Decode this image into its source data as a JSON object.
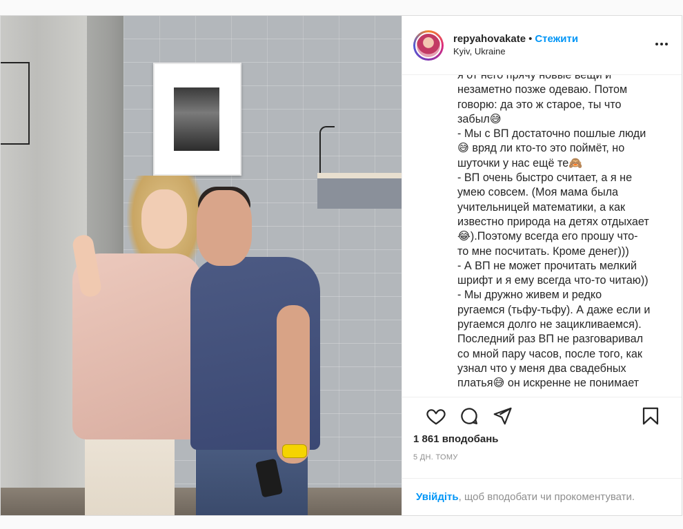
{
  "post": {
    "username": "repyahovakate",
    "separator": "•",
    "follow_label": "Стежити",
    "location": "Kyiv, Ukraine",
    "caption": "я от него прячу новые вещи и\nнезаметно позже одеваю. Потом\nговорю: да это ж старое, ты что\nзабыл😅\n- Мы с ВП достаточно пошлые люди\n😅 вряд ли кто-то это поймёт, но\nшуточки у нас ещё те🙈\n- ВП очень быстро считает, а я не\nумею совсем. (Моя мама была\nучительницей математики, а как\nизвестно природа на детях отдыхает\n😂).Поэтому всегда его прошу что-\nто мне посчитать. Кроме денег)))\n- А ВП не может прочитать мелкий\nшрифт и я ему всегда что-то читаю))\n- Мы дружно живем и редко\nругаемся (тьфу-тьфу). А даже если и\nругаемся долго не зацикливаемся).\nПоследний раз ВП не разговаривал\nсо мной пару часов, после того, как\nузнал что у меня два свадебных\nплатья😅 он искренне не понимает",
    "likes": "1 861 вподобань",
    "date": "5 ДН. ТОМУ",
    "login_link": "Увійдіть",
    "login_text": ", щоб вподобати чи прокоментувати."
  },
  "icons": {
    "more": "more-options-icon",
    "like": "heart-icon",
    "comment": "comment-icon",
    "share": "share-icon",
    "save": "bookmark-icon"
  }
}
